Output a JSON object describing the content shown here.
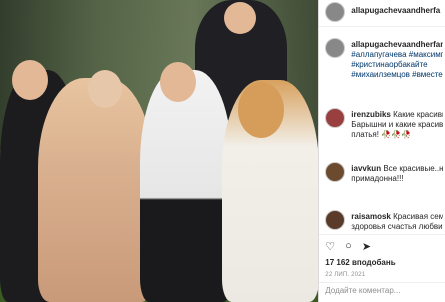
{
  "post": {
    "author": "allapugachevaandherfa",
    "caption_author": "allapugachevaandherfami",
    "tags": [
      "#аллапугачева #максимга",
      "#кристинаорбакайте",
      "#михаилземцов #вместе"
    ],
    "comments": [
      {
        "user": "irenzubiks",
        "text": "Какие красивые",
        "text2": "Барышни и какие красивые",
        "text3": "платья! 🥀🥀🥀"
      },
      {
        "user": "iavvkun",
        "text": "Все красивые..но",
        "text2": "примадонна!!!"
      },
      {
        "user": "raisamosk",
        "text": "Красивая семья",
        "text2": "здоровья счастья любви"
      }
    ],
    "likes": "17 162 вподобань",
    "date": "22 ЛИП. 2021",
    "add_comment_placeholder": "Додайте коментар..."
  }
}
